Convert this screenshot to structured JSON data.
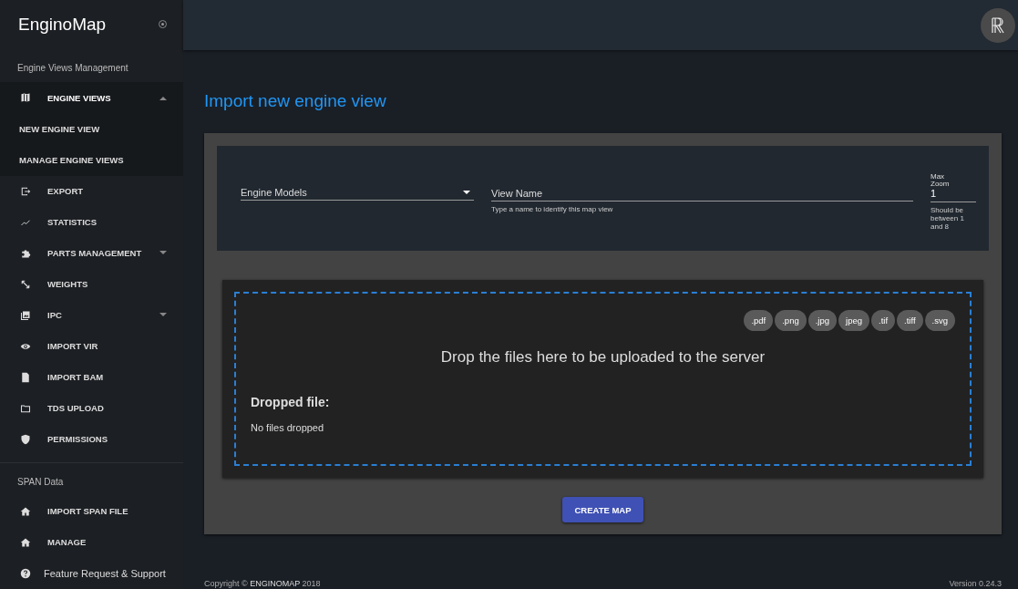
{
  "sidebar": {
    "brand": "EnginoMap",
    "sections": [
      {
        "title": "Engine Views Management",
        "items": [
          {
            "label": "ENGINE VIEWS",
            "expanded": true,
            "children": [
              {
                "label": "NEW ENGINE VIEW"
              },
              {
                "label": "MANAGE ENGINE VIEWS"
              }
            ]
          },
          {
            "label": "EXPORT"
          },
          {
            "label": "STATISTICS"
          },
          {
            "label": "PARTS MANAGEMENT",
            "expanded": false
          },
          {
            "label": "WEIGHTS"
          },
          {
            "label": "IPC",
            "expanded": false
          },
          {
            "label": "IMPORT VIR"
          },
          {
            "label": "IMPORT BAM"
          },
          {
            "label": "TDS UPLOAD"
          },
          {
            "label": "PERMISSIONS"
          }
        ]
      },
      {
        "title": "SPAN Data",
        "items": [
          {
            "label": "IMPORT SPAN FILE"
          },
          {
            "label": "MANAGE"
          }
        ]
      }
    ],
    "support": "Feature Request & Support"
  },
  "page": {
    "title": "Import new engine view",
    "form": {
      "engine_models": {
        "placeholder": "Engine Models"
      },
      "view_name": {
        "placeholder": "View Name",
        "hint": "Type a name to identify this map view"
      },
      "max_zoom": {
        "label": "Max Zoom",
        "value": "1",
        "hint": "Should be between 1 and 8"
      }
    },
    "dropzone": {
      "file_types": [
        ".pdf",
        ".png",
        ".jpg",
        "jpeg",
        ".tif",
        ".tiff",
        ".svg"
      ],
      "message": "Drop the files here to be uploaded to the server",
      "dropped_title": "Dropped file:",
      "dropped_text": "No files dropped"
    },
    "button": "CREATE MAP"
  },
  "footer": {
    "copyright": "Copyright © **ENGINOMAP** 2018",
    "version": "Version 0.24.3"
  }
}
